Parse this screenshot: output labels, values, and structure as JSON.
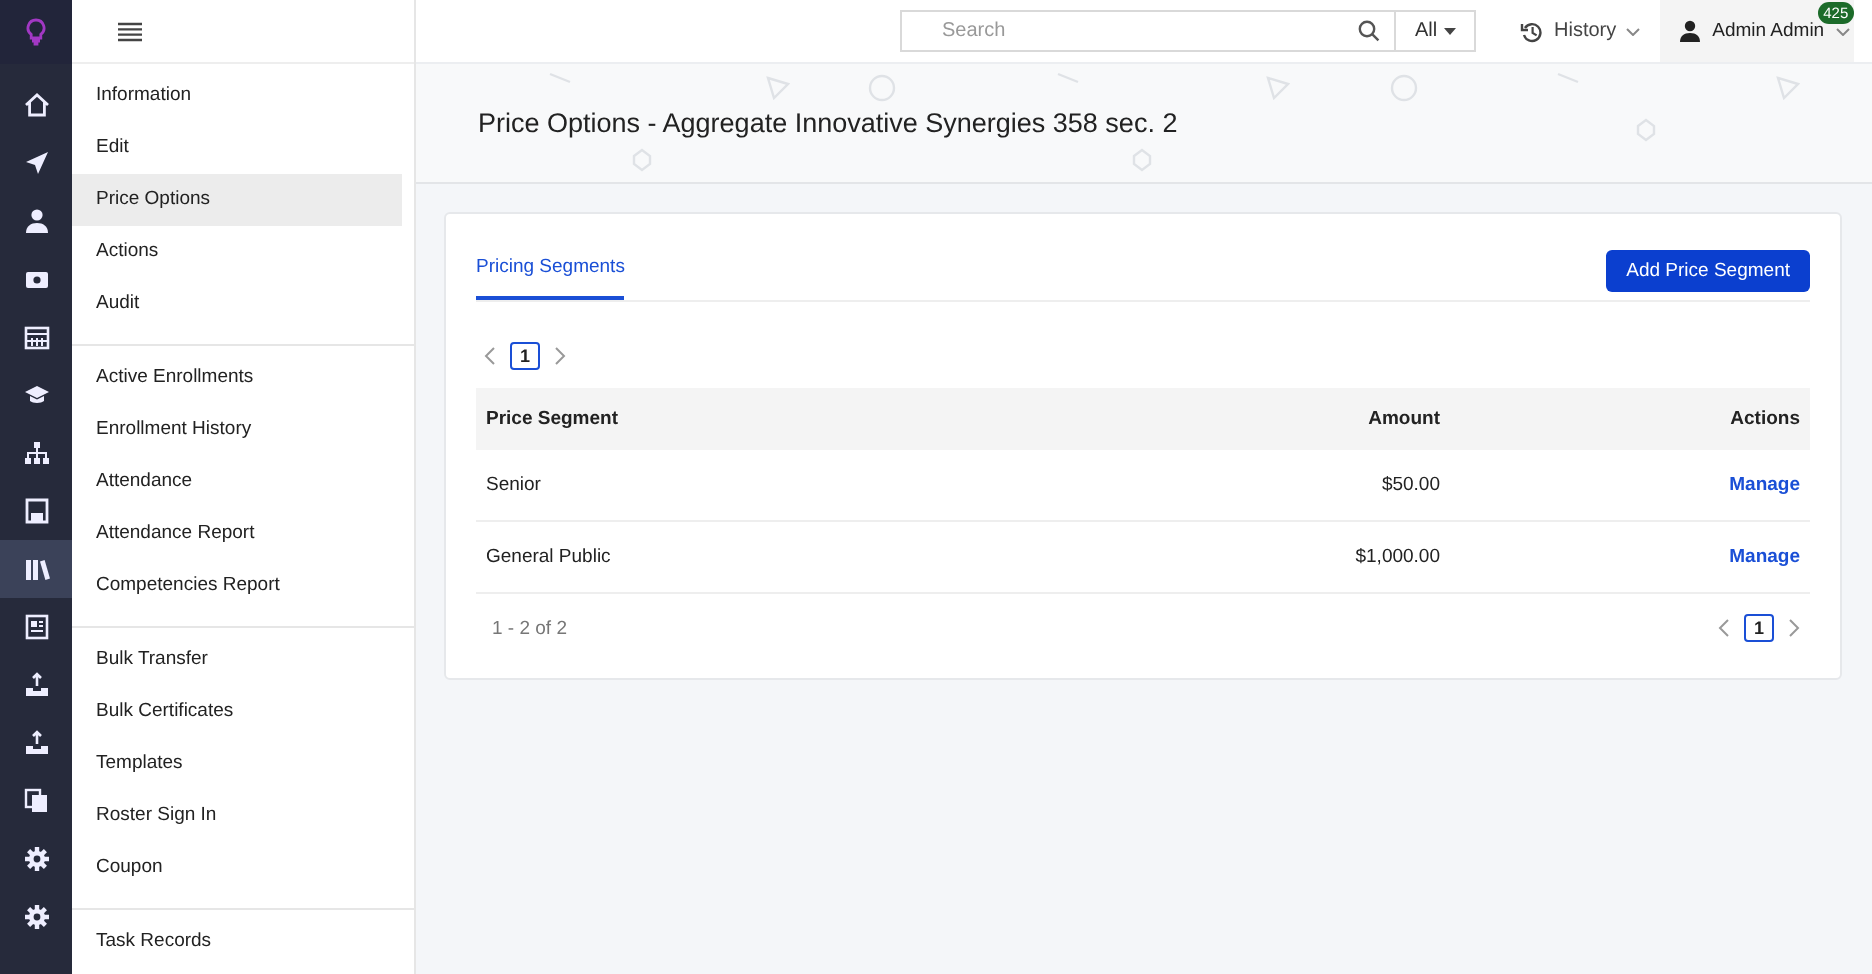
{
  "rail": [
    {
      "kind": "home",
      "selected": false
    },
    {
      "kind": "send",
      "selected": false
    },
    {
      "kind": "person",
      "selected": false
    },
    {
      "kind": "money",
      "selected": false
    },
    {
      "kind": "calendar",
      "selected": false
    },
    {
      "kind": "cap",
      "selected": false
    },
    {
      "kind": "org",
      "selected": false
    },
    {
      "kind": "save",
      "selected": false
    },
    {
      "kind": "books",
      "selected": true
    },
    {
      "kind": "doc",
      "selected": false
    },
    {
      "kind": "upload",
      "selected": false
    },
    {
      "kind": "upload",
      "selected": false
    },
    {
      "kind": "copy",
      "selected": false
    },
    {
      "kind": "gear",
      "selected": false
    },
    {
      "kind": "gear",
      "selected": false
    }
  ],
  "topbar": {
    "search": {
      "placeholder": "Search"
    },
    "scope": "All",
    "history": "History",
    "user": {
      "name": "Admin Admin",
      "badge": "425"
    }
  },
  "menu": [
    [
      {
        "label": "Information",
        "selected": false
      },
      {
        "label": "Edit",
        "selected": false
      },
      {
        "label": "Price Options",
        "selected": true
      },
      {
        "label": "Actions",
        "selected": false
      },
      {
        "label": "Audit",
        "selected": false
      }
    ],
    [
      {
        "label": "Active Enrollments",
        "selected": false
      },
      {
        "label": "Enrollment History",
        "selected": false
      },
      {
        "label": "Attendance",
        "selected": false
      },
      {
        "label": "Attendance Report",
        "selected": false
      },
      {
        "label": "Competencies Report",
        "selected": false
      }
    ],
    [
      {
        "label": "Bulk Transfer",
        "selected": false
      },
      {
        "label": "Bulk Certificates",
        "selected": false
      },
      {
        "label": "Templates",
        "selected": false
      },
      {
        "label": "Roster Sign In",
        "selected": false
      },
      {
        "label": "Coupon",
        "selected": false
      }
    ],
    [
      {
        "label": "Task Records",
        "selected": false
      }
    ]
  ],
  "page": {
    "title": "Price Options - Aggregate Innovative Synergies 358 sec. 2"
  },
  "tabs": [
    {
      "label": "Pricing Segments",
      "selected": true
    }
  ],
  "add_button": "Add Price Segment",
  "pager_top": [
    {
      "label": "1",
      "selected": true
    }
  ],
  "table": {
    "columns": [
      "Price Segment",
      "Amount",
      "Actions"
    ],
    "rows": [
      {
        "segment": "Senior",
        "amount": "$50.00",
        "action": "Manage"
      },
      {
        "segment": "General Public",
        "amount": "$1,000.00",
        "action": "Manage"
      }
    ]
  },
  "footer": {
    "range": "1 - 2 of 2",
    "pages": [
      {
        "label": "1",
        "selected": true
      }
    ]
  }
}
